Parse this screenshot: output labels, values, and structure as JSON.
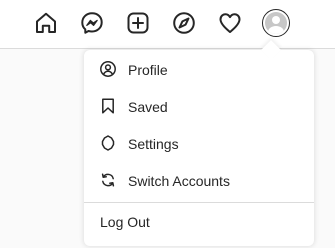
{
  "nav": {
    "icons": [
      "home-icon",
      "direct-messages-icon",
      "new-post-icon",
      "explore-icon",
      "activity-heart-icon",
      "avatar"
    ]
  },
  "menu": {
    "items": [
      {
        "label": "Profile",
        "icon": "profile-icon"
      },
      {
        "label": "Saved",
        "icon": "bookmark-icon"
      },
      {
        "label": "Settings",
        "icon": "settings-gear-icon"
      },
      {
        "label": "Switch Accounts",
        "icon": "switch-accounts-icon"
      }
    ],
    "logout_label": "Log Out"
  },
  "colors": {
    "icon": "#262626",
    "text": "#262626",
    "divider": "#dbdbdb",
    "background": "#fafafa",
    "avatar_fill": "#c7c7c7"
  }
}
